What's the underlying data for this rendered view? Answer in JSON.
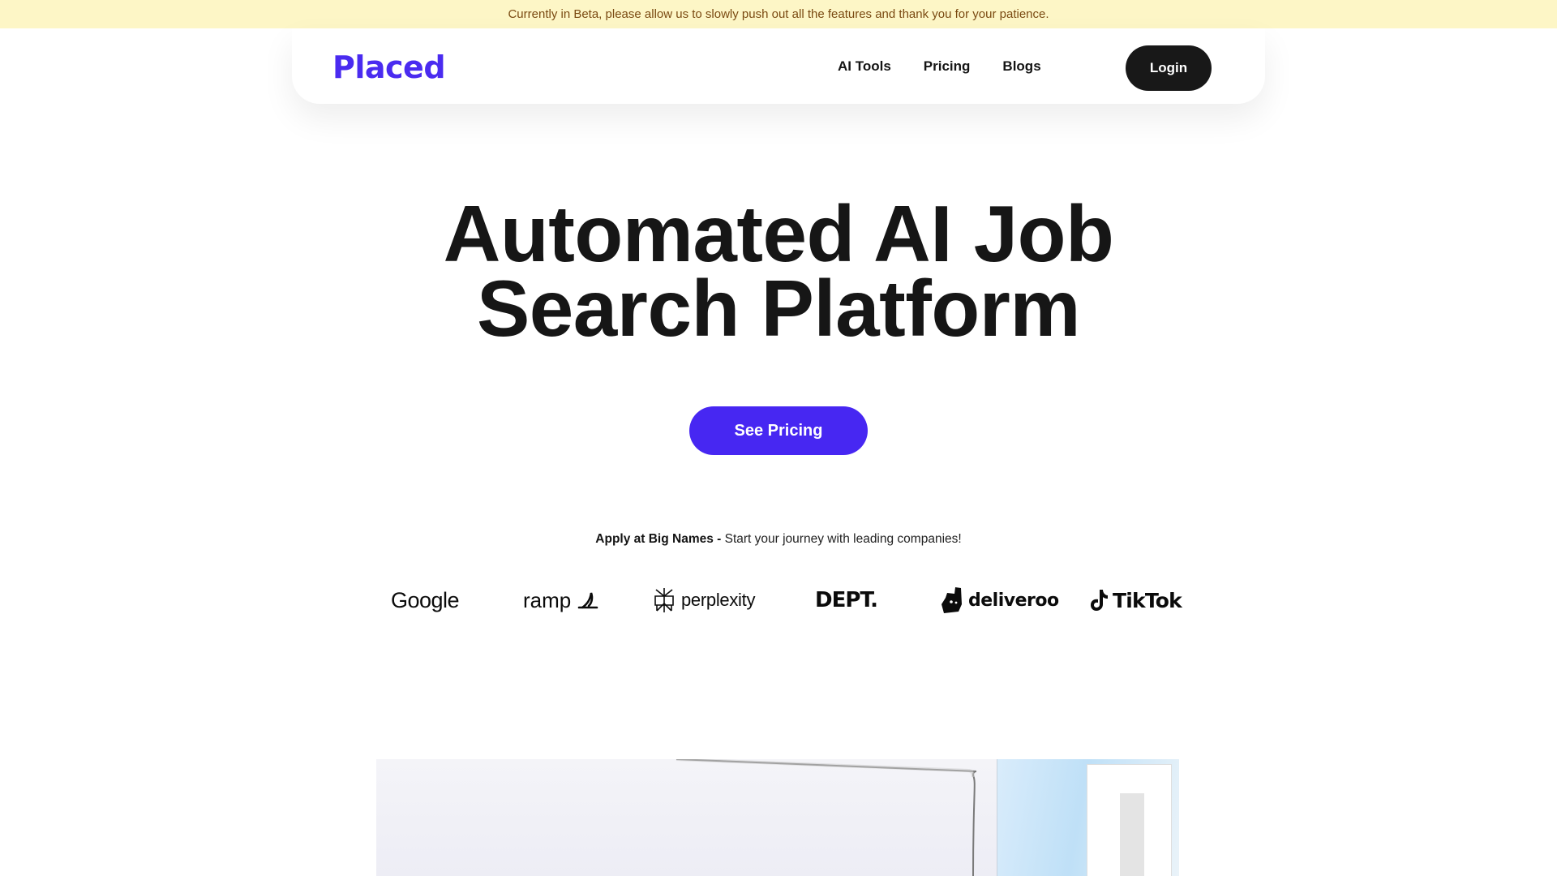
{
  "banner": {
    "text": "Currently in Beta, please allow us to slowly push out all the features and thank you for your patience."
  },
  "nav": {
    "logo": "Placed",
    "links": [
      "AI Tools",
      "Pricing",
      "Blogs"
    ],
    "login_label": "Login"
  },
  "hero": {
    "title_line1": "Automated AI Job",
    "title_line2": "Search Platform",
    "cta_label": "See Pricing"
  },
  "companies": {
    "intro_bold": "Apply at Big Names -",
    "intro_rest": " Start your journey with leading companies!",
    "logos": [
      "Google",
      "ramp",
      "perplexity",
      "DEPT.",
      "deliveroo",
      "TikTok"
    ]
  },
  "colors": {
    "brand": "#4a2bf0",
    "cta": "#4727f2",
    "banner_bg": "#fdf6c6",
    "banner_text": "#7a4a12",
    "dark_button": "#181818"
  }
}
